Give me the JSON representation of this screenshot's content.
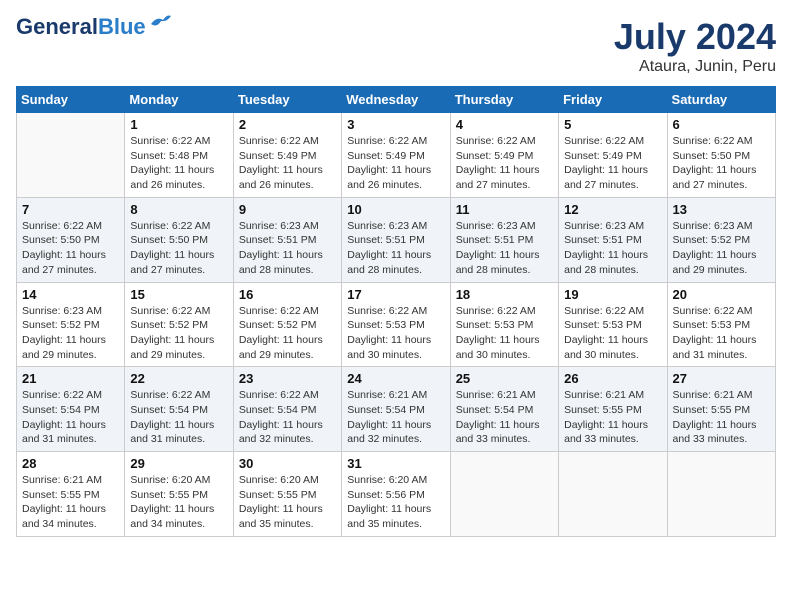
{
  "logo": {
    "text_general": "General",
    "text_blue": "Blue"
  },
  "title": "July 2024",
  "subtitle": "Ataura, Junin, Peru",
  "days_of_week": [
    "Sunday",
    "Monday",
    "Tuesday",
    "Wednesday",
    "Thursday",
    "Friday",
    "Saturday"
  ],
  "weeks": [
    [
      {
        "day": "",
        "info": ""
      },
      {
        "day": "1",
        "info": "Sunrise: 6:22 AM\nSunset: 5:48 PM\nDaylight: 11 hours\nand 26 minutes."
      },
      {
        "day": "2",
        "info": "Sunrise: 6:22 AM\nSunset: 5:49 PM\nDaylight: 11 hours\nand 26 minutes."
      },
      {
        "day": "3",
        "info": "Sunrise: 6:22 AM\nSunset: 5:49 PM\nDaylight: 11 hours\nand 26 minutes."
      },
      {
        "day": "4",
        "info": "Sunrise: 6:22 AM\nSunset: 5:49 PM\nDaylight: 11 hours\nand 27 minutes."
      },
      {
        "day": "5",
        "info": "Sunrise: 6:22 AM\nSunset: 5:49 PM\nDaylight: 11 hours\nand 27 minutes."
      },
      {
        "day": "6",
        "info": "Sunrise: 6:22 AM\nSunset: 5:50 PM\nDaylight: 11 hours\nand 27 minutes."
      }
    ],
    [
      {
        "day": "7",
        "info": "Sunrise: 6:22 AM\nSunset: 5:50 PM\nDaylight: 11 hours\nand 27 minutes."
      },
      {
        "day": "8",
        "info": "Sunrise: 6:22 AM\nSunset: 5:50 PM\nDaylight: 11 hours\nand 27 minutes."
      },
      {
        "day": "9",
        "info": "Sunrise: 6:23 AM\nSunset: 5:51 PM\nDaylight: 11 hours\nand 28 minutes."
      },
      {
        "day": "10",
        "info": "Sunrise: 6:23 AM\nSunset: 5:51 PM\nDaylight: 11 hours\nand 28 minutes."
      },
      {
        "day": "11",
        "info": "Sunrise: 6:23 AM\nSunset: 5:51 PM\nDaylight: 11 hours\nand 28 minutes."
      },
      {
        "day": "12",
        "info": "Sunrise: 6:23 AM\nSunset: 5:51 PM\nDaylight: 11 hours\nand 28 minutes."
      },
      {
        "day": "13",
        "info": "Sunrise: 6:23 AM\nSunset: 5:52 PM\nDaylight: 11 hours\nand 29 minutes."
      }
    ],
    [
      {
        "day": "14",
        "info": "Sunrise: 6:23 AM\nSunset: 5:52 PM\nDaylight: 11 hours\nand 29 minutes."
      },
      {
        "day": "15",
        "info": "Sunrise: 6:22 AM\nSunset: 5:52 PM\nDaylight: 11 hours\nand 29 minutes."
      },
      {
        "day": "16",
        "info": "Sunrise: 6:22 AM\nSunset: 5:52 PM\nDaylight: 11 hours\nand 29 minutes."
      },
      {
        "day": "17",
        "info": "Sunrise: 6:22 AM\nSunset: 5:53 PM\nDaylight: 11 hours\nand 30 minutes."
      },
      {
        "day": "18",
        "info": "Sunrise: 6:22 AM\nSunset: 5:53 PM\nDaylight: 11 hours\nand 30 minutes."
      },
      {
        "day": "19",
        "info": "Sunrise: 6:22 AM\nSunset: 5:53 PM\nDaylight: 11 hours\nand 30 minutes."
      },
      {
        "day": "20",
        "info": "Sunrise: 6:22 AM\nSunset: 5:53 PM\nDaylight: 11 hours\nand 31 minutes."
      }
    ],
    [
      {
        "day": "21",
        "info": "Sunrise: 6:22 AM\nSunset: 5:54 PM\nDaylight: 11 hours\nand 31 minutes."
      },
      {
        "day": "22",
        "info": "Sunrise: 6:22 AM\nSunset: 5:54 PM\nDaylight: 11 hours\nand 31 minutes."
      },
      {
        "day": "23",
        "info": "Sunrise: 6:22 AM\nSunset: 5:54 PM\nDaylight: 11 hours\nand 32 minutes."
      },
      {
        "day": "24",
        "info": "Sunrise: 6:21 AM\nSunset: 5:54 PM\nDaylight: 11 hours\nand 32 minutes."
      },
      {
        "day": "25",
        "info": "Sunrise: 6:21 AM\nSunset: 5:54 PM\nDaylight: 11 hours\nand 33 minutes."
      },
      {
        "day": "26",
        "info": "Sunrise: 6:21 AM\nSunset: 5:55 PM\nDaylight: 11 hours\nand 33 minutes."
      },
      {
        "day": "27",
        "info": "Sunrise: 6:21 AM\nSunset: 5:55 PM\nDaylight: 11 hours\nand 33 minutes."
      }
    ],
    [
      {
        "day": "28",
        "info": "Sunrise: 6:21 AM\nSunset: 5:55 PM\nDaylight: 11 hours\nand 34 minutes."
      },
      {
        "day": "29",
        "info": "Sunrise: 6:20 AM\nSunset: 5:55 PM\nDaylight: 11 hours\nand 34 minutes."
      },
      {
        "day": "30",
        "info": "Sunrise: 6:20 AM\nSunset: 5:55 PM\nDaylight: 11 hours\nand 35 minutes."
      },
      {
        "day": "31",
        "info": "Sunrise: 6:20 AM\nSunset: 5:56 PM\nDaylight: 11 hours\nand 35 minutes."
      },
      {
        "day": "",
        "info": ""
      },
      {
        "day": "",
        "info": ""
      },
      {
        "day": "",
        "info": ""
      }
    ]
  ]
}
